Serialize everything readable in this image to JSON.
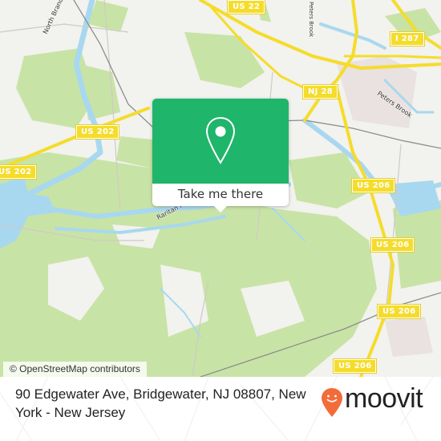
{
  "map": {
    "road_shields": [
      "US 22",
      "I 287",
      "NJ 28",
      "US 202",
      "US 202",
      "US 206",
      "US 206",
      "US 206",
      "US 206"
    ],
    "labels": {
      "north_branch": "North Branch Raritan River",
      "peters_brook_top": "Peters Brook",
      "peters_brook": "Peters Brook",
      "raritan_power_canal": "Raritan Power Canal"
    },
    "colors": {
      "land": "#f2f2ee",
      "park": "#c8e3a6",
      "water": "#a8d8ef",
      "road": "#f5dc2b",
      "accent": "#1fb56b"
    },
    "attribution": "© OpenStreetMap contributors"
  },
  "popup": {
    "icon": "map-pin-icon",
    "button_label": "Take me there"
  },
  "footer": {
    "address": "90 Edgewater Ave, Bridgewater, NJ 08807, New York - New Jersey",
    "logo_text": "moovit",
    "logo_color": "#f26c3a"
  }
}
